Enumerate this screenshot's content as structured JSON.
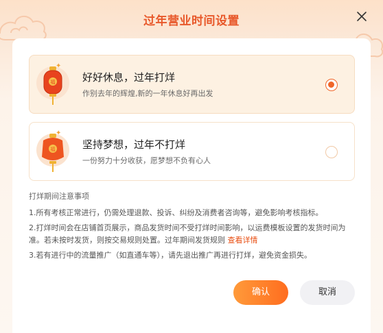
{
  "dialog": {
    "title": "过年营业时间设置",
    "close_icon": "close-icon"
  },
  "options": [
    {
      "title": "好好休息，过年打烊",
      "subtitle": "作别去年的辉煌,新的一年休息好再出发",
      "selected": true,
      "icon": "lantern-icon"
    },
    {
      "title": "坚持梦想，过年不打烊",
      "subtitle": "一份努力十分收获，愿梦想不负有心人",
      "selected": false,
      "icon": "lantern-icon"
    }
  ],
  "notes": {
    "heading": "打烊期间注意事项",
    "item1": "1.所有考核正常进行，仍需处理退款、投诉、纠纷及消费者咨询等，避免影响考核指标。",
    "item2_text": "2.打烊时间会在店铺首页展示，商品发货时间不受打烊时间影响，以运费模板设置的发货时间为准。若未按时发货，则按交易规则处置。过年期间发货规则 ",
    "item2_link": "查看详情",
    "item3": "3.若有进行中的流量推广（如直通车等），请先退出推广再进行打烊，避免资金损失。"
  },
  "buttons": {
    "confirm": "确认",
    "cancel": "取消"
  },
  "colors": {
    "accent": "#f0662a",
    "title": "#e8582a",
    "link": "#e84e12"
  }
}
